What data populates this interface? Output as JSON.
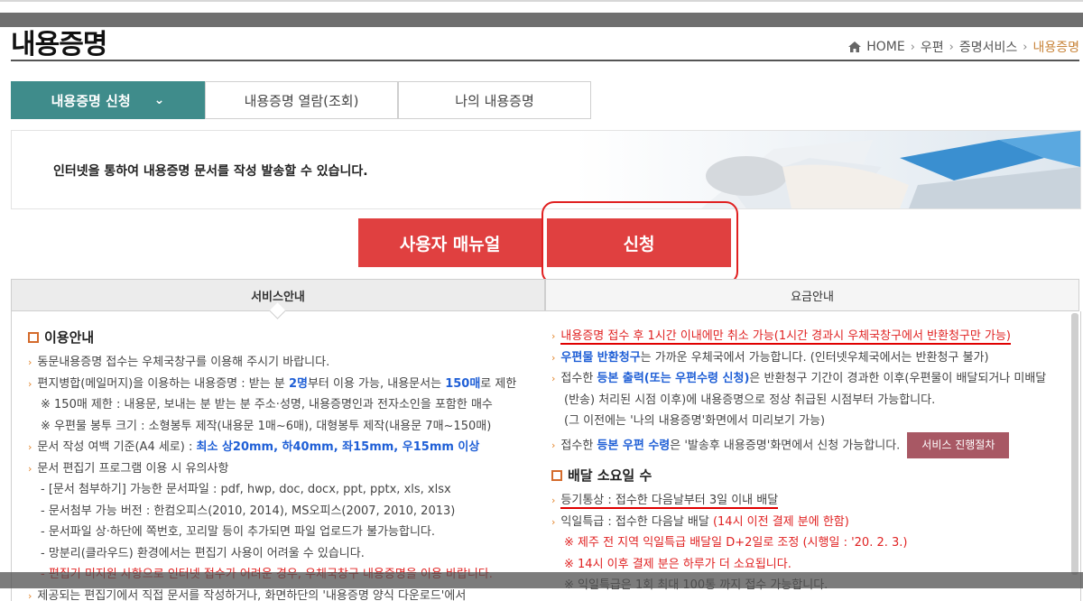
{
  "header": {
    "title": "내용증명",
    "breadcrumb": [
      "HOME",
      "우편",
      "증명서비스",
      "내용증명"
    ]
  },
  "tabs": [
    {
      "label": "내용증명 신청",
      "active": true
    },
    {
      "label": "내용증명 열람(조회)",
      "active": false
    },
    {
      "label": "나의 내용증명",
      "active": false
    }
  ],
  "banner": {
    "text": "인터넷을 통하여 내용증명 문서를 작성 발송할 수 있습니다."
  },
  "buttons": {
    "manual": "사용자 매뉴얼",
    "apply": "신청"
  },
  "service_tabs": [
    {
      "label": "서비스안내",
      "active": true
    },
    {
      "label": "요금안내",
      "active": false
    }
  ],
  "usage": {
    "heading": "이용안내",
    "l1": "동문내용증명 접수는 우체국창구를 이용해 주시기 바랍니다.",
    "l2a": "편지병합(메일머지)을 이용하는 내용증명 : 받는 분 ",
    "l2b": "2명",
    "l2c": "부터 이용 가능, 내용문서는 ",
    "l2d": "150매",
    "l2e": "로 제한",
    "l3": "※ 150매 제한 : 내용문, 보내는 분 받는 분 주소·성명, 내용증명인과 전자소인을 포함한 매수",
    "l4": "※ 우편물 봉투 크기 : 소형봉투 제작(내용문 1매~6매), 대형봉투 제작(내용문 7매~150매)",
    "l5a": "문서 작성 여백 기준(A4 세로) : ",
    "l5b": "최소 상20mm, 하40mm, 좌15mm, 우15mm 이상",
    "l6": "문서 편집기 프로그램 이용 시 유의사항",
    "l7": "- [문서 첨부하기] 가능한 문서파일 : pdf, hwp, doc, docx, ppt, pptx, xls, xlsx",
    "l8": "- 문서첨부 가능 버전 : 한컴오피스(2010, 2014), MS오피스(2007, 2010, 2013)",
    "l9": "- 문서파일 상·하단에 쪽번호, 꼬리말 등이 추가되면 파일 업로드가 불가능합니다.",
    "l10": "- 망분리(클라우드) 환경에서는 편집기 사용이 어려울 수 있습니다.",
    "l11": "- 편집기 미지원 사항으로 인터넷 접수가 어려운 경우, 우체국창구 내용증명을 이용 바랍니다.",
    "l12": "제공되는 편집기에서 직접 문서를 작성하거나, 화면하단의 '내용증명 양식 다운로드'에서"
  },
  "right": {
    "r1": "내용증명 접수 후 1시간 이내에만 취소 가능(1시간 경과시 우체국창구에서 반환청구만 가능)",
    "r2a": "우편물 반환청구",
    "r2b": "는 가까운 우체국에서 가능합니다. (인터넷우체국에서는 반환청구 불가)",
    "r3a": "접수한 ",
    "r3b": "등본 출력(또는 우편수령 신청)",
    "r3c": "은 반환청구 기간이 경과한 이후(우편물이 배달되거나 미배달",
    "r4": "(반송) 처리된 시점 이후)에 내용증명으로 정상 취급된 시점부터 가능합니다.",
    "r5": "(그 이전에는 '나의 내용증명'화면에서 미리보기 가능)",
    "r6a": "접수한 ",
    "r6b": "등본 우편 수령",
    "r6c": "은 '발송후 내용증명'화면에서 신청 가능합니다.",
    "r6btn": "서비스 진행절차",
    "delivery_heading": "배달 소요일 수",
    "d1": "등기통상 : 접수한 다음날부터 3일 이내 배달",
    "d2a": "익일특급 : 접수한 다음날 배달 ",
    "d2b": "(14시 이전 결제 분에 한함)",
    "d3": "※ 제주 전 지역 익일특급 배달일 D+2일로 조정 (시행일 : '20. 2. 3.)",
    "d4": "※ 14시 이후 결제 분은 하루가 더 소요됩니다.",
    "d5": "※ 익일특급은 1회 최대 100통 까지 접수 가능합니다."
  },
  "colors": {
    "accent_teal": "#3f8c8b",
    "button_red": "#e04040",
    "link_blue": "#1f5fd6",
    "warn_red": "#e02222",
    "bullet_orange": "#e3862d"
  }
}
